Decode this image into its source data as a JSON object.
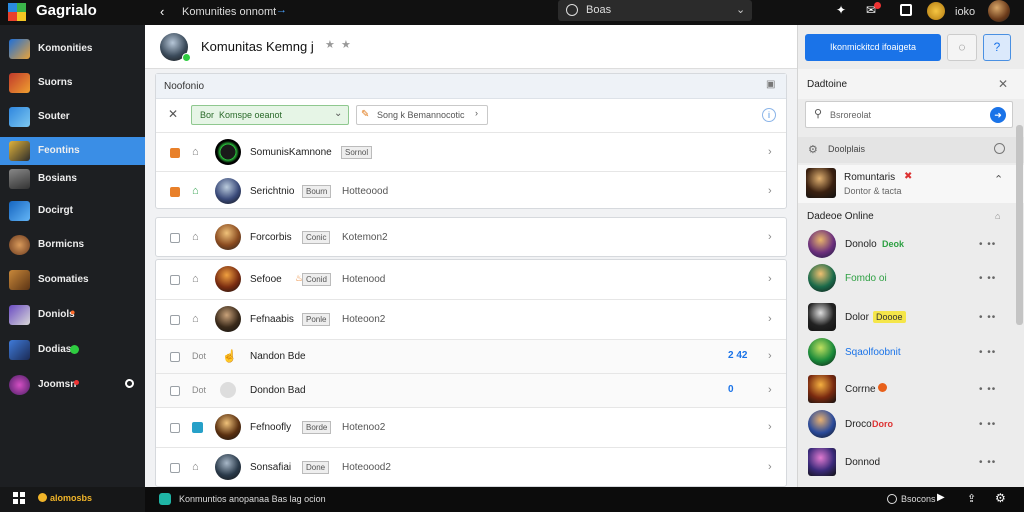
{
  "topbar": {
    "brand": "Gagrialo",
    "breadcrumb": "Komunities onnomt",
    "search_value": "Boas",
    "user_label": "ioko"
  },
  "sidebar": {
    "items": [
      {
        "label": "Komonities"
      },
      {
        "label": "Suorns"
      },
      {
        "label": "Souter"
      },
      {
        "label": "Feontins"
      },
      {
        "label": "Bosians"
      },
      {
        "label": "Docirgt"
      },
      {
        "label": "Bormicns"
      },
      {
        "label": "Soomaties"
      },
      {
        "label": "Doniols"
      },
      {
        "label": "Dodias"
      },
      {
        "label": "Joomsn"
      }
    ],
    "footer_label": "alomosbs"
  },
  "header": {
    "title": "Komunitas Kemng j",
    "primary_button": "Ikonmickitcd ifoaigeta"
  },
  "list": {
    "section_title": "Noofonio",
    "filter1": "Bor  Komspe oeanot",
    "filter2": "Song k Bemannocotic",
    "rows": [
      {
        "name": "SomunisKamnone",
        "tag": "Sornol",
        "sub": ""
      },
      {
        "name": "Serichtnio",
        "tag": "Bourn",
        "sub": "Hotteoood"
      },
      {
        "name": "Forcorbis",
        "tag": "Conic",
        "sub": "Kotemon2"
      },
      {
        "name": "Sefooe",
        "tag": "Conid",
        "sub": "Hotenood"
      },
      {
        "name": "Fefnaabis",
        "tag": "Ponle",
        "sub": "Hoteoon2"
      },
      {
        "name": "Nandon Bde",
        "tag": "",
        "sub": "",
        "count": "2 42",
        "prefix": "Dot"
      },
      {
        "name": "Dondon Bad",
        "tag": "",
        "sub": "",
        "count": "0",
        "prefix": "Dot"
      },
      {
        "name": "Fefnoofly",
        "tag": "Borde",
        "sub": "Hotenoo2"
      },
      {
        "name": "Sonsafiai",
        "tag": "Done",
        "sub": "Hoteoood2"
      }
    ]
  },
  "right_panel": {
    "title": "Dadtoine",
    "search_placeholder": "Bsroreolat",
    "section_label": "Doolplais",
    "featured": {
      "name": "Romuntaris",
      "sub": "Dontor & tacta"
    },
    "online_title": "Dadeoe Online",
    "members": [
      {
        "name": "Donolo",
        "badge": "Deok"
      },
      {
        "name": "Fomdo oi",
        "badge": ""
      },
      {
        "name": "Dolor",
        "badge": "Doooe"
      },
      {
        "name": "Sqaolfoobnit",
        "badge": ""
      },
      {
        "name": "Corrne",
        "badge": ""
      },
      {
        "name": "Droco",
        "badge": "Doro"
      },
      {
        "name": "Donnod",
        "badge": ""
      }
    ]
  },
  "bottombar": {
    "status_text": "Konmuntios anopanaa Bas lag ocion",
    "right_label": "Bsocons"
  }
}
